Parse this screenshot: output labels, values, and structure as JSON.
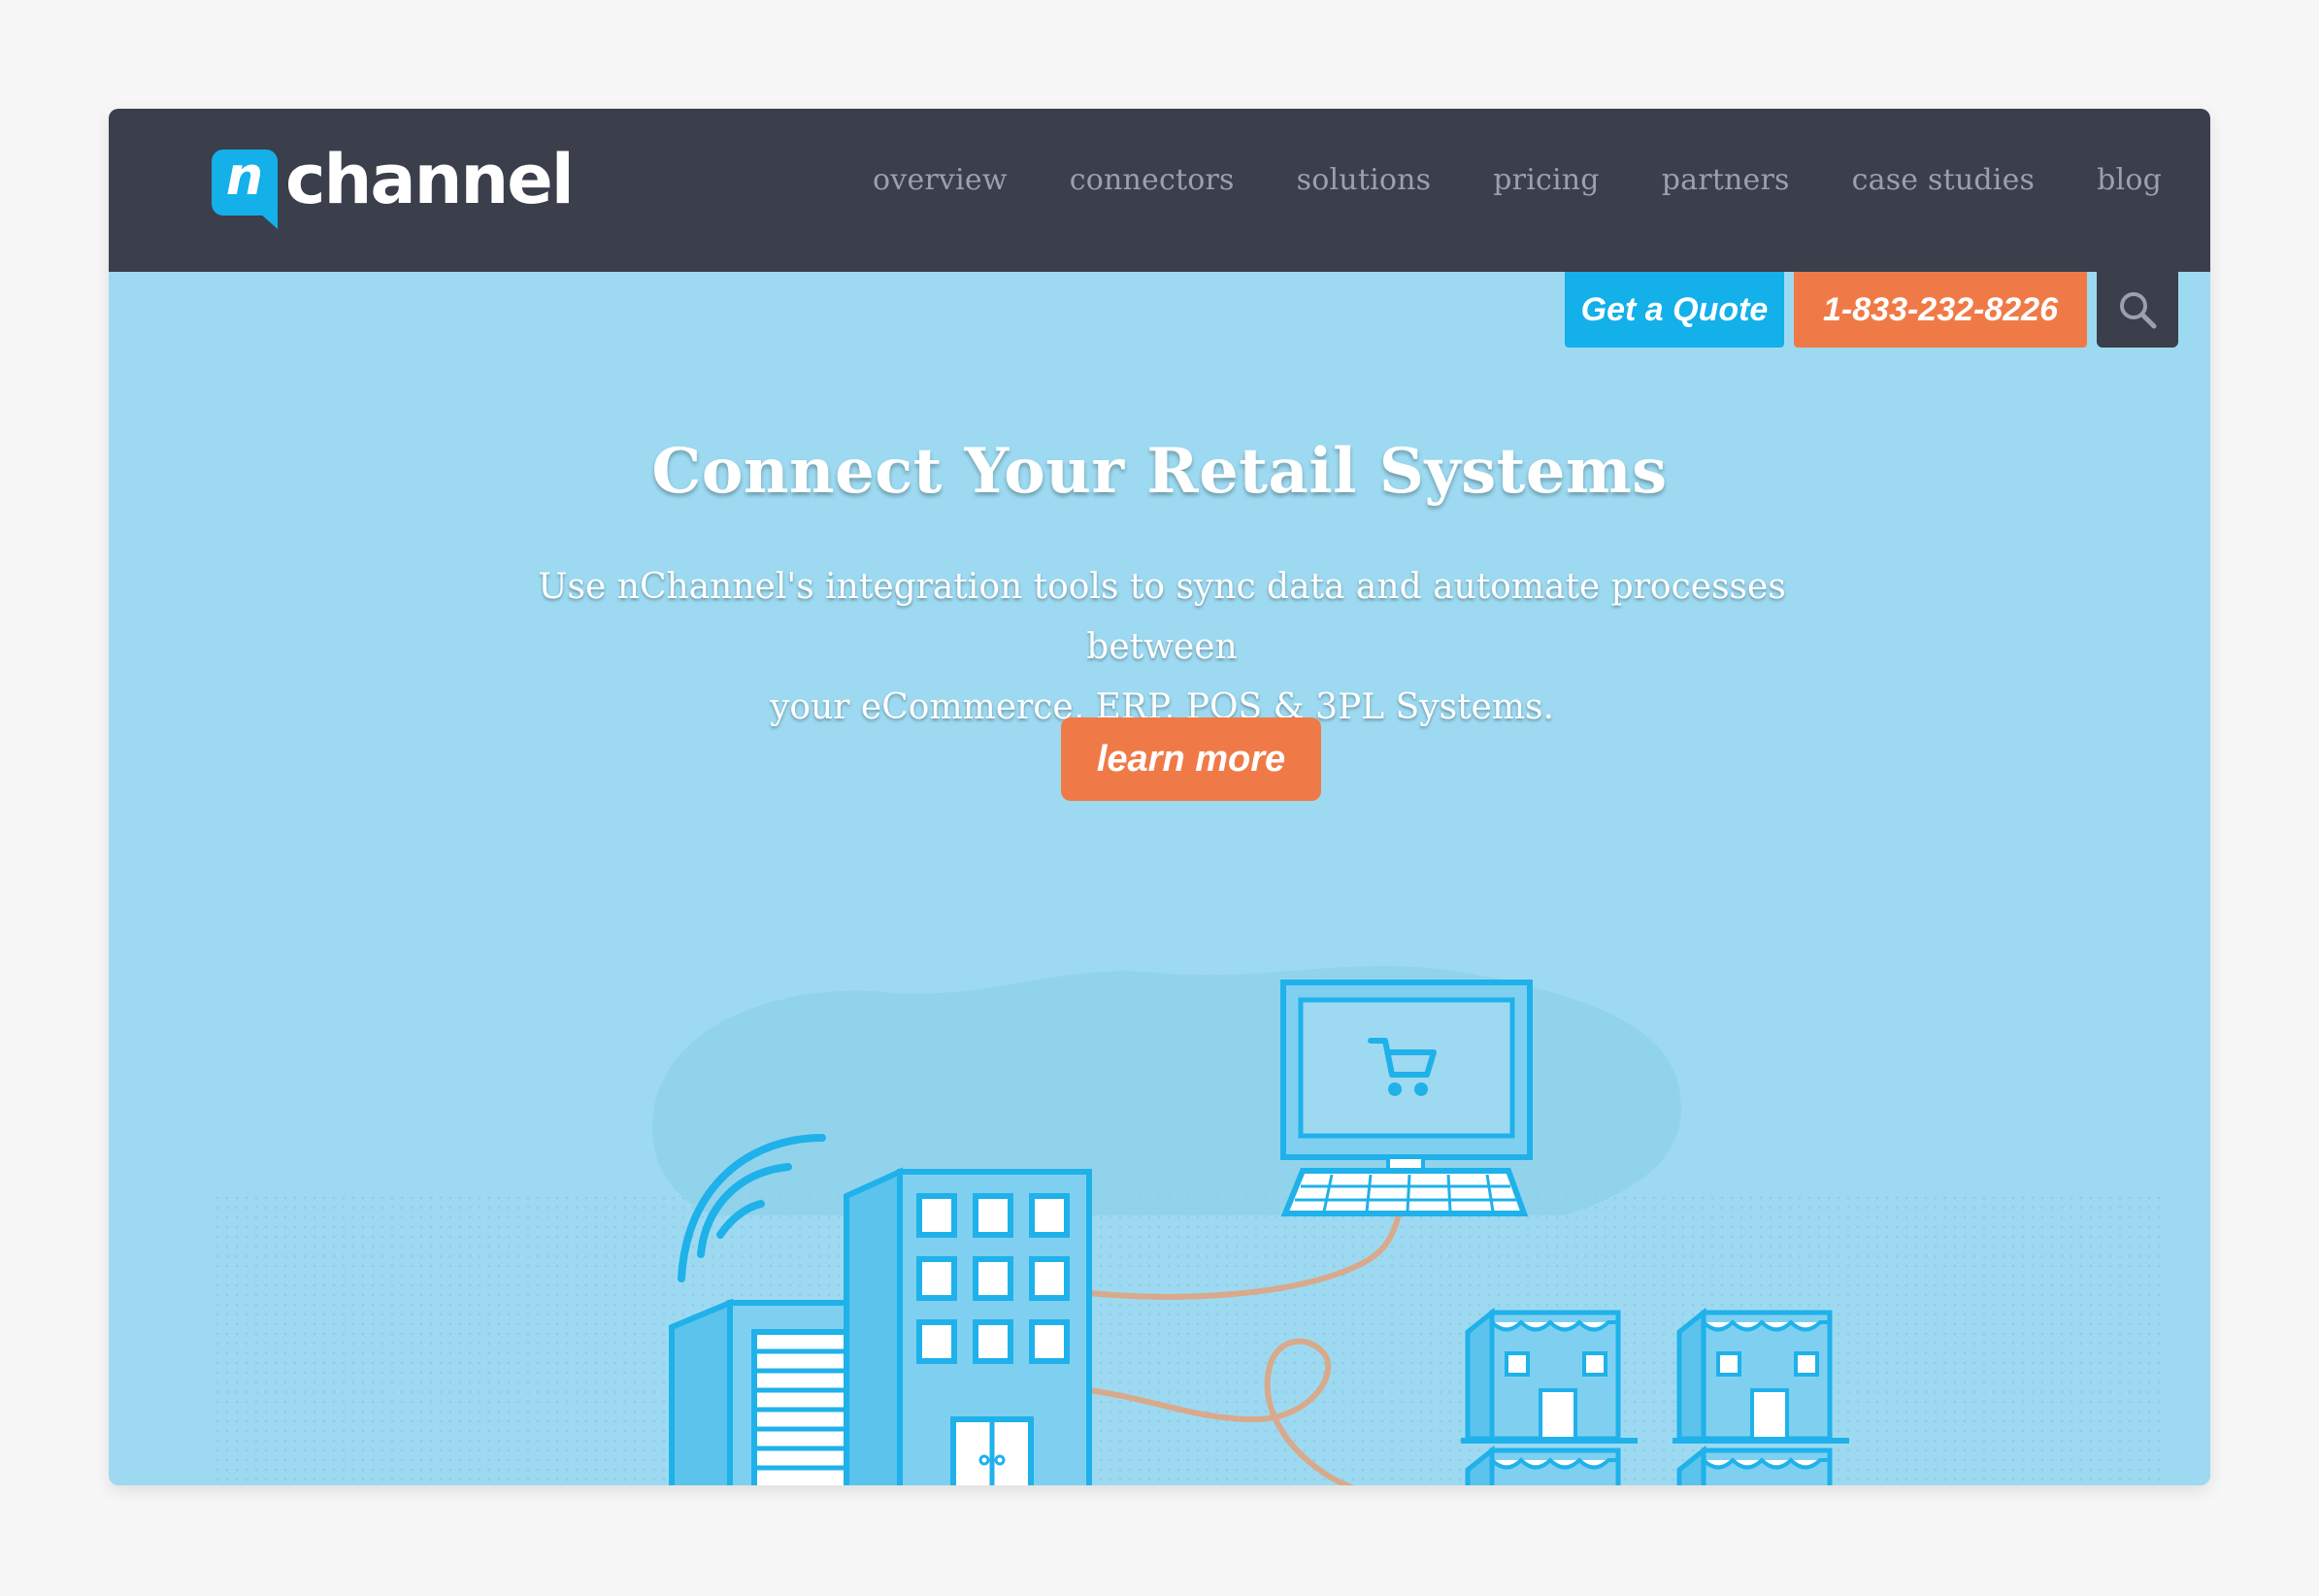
{
  "brand": {
    "mark_letter": "n",
    "wordmark": "channel"
  },
  "nav": {
    "items": [
      "overview",
      "connectors",
      "solutions",
      "pricing",
      "partners",
      "case studies",
      "blog"
    ]
  },
  "actions": {
    "quote_label": "Get a Quote",
    "phone_label": "1-833-232-8226"
  },
  "hero": {
    "title": "Connect Your Retail Systems",
    "subtitle_line1": "Use nChannel's integration tools to sync data and automate processes between",
    "subtitle_line2": "your eCommerce, ERP, POS & 3PL Systems.",
    "cta_label": "learn more"
  },
  "colors": {
    "header_bg": "#3b3e4b",
    "hero_bg": "#9ddaf1",
    "brand_blue": "#13b0ea",
    "accent_orange": "#f07a47",
    "nav_text": "#9aa0ad"
  },
  "icons": [
    "search-icon",
    "cart-icon",
    "wifi-icon"
  ]
}
